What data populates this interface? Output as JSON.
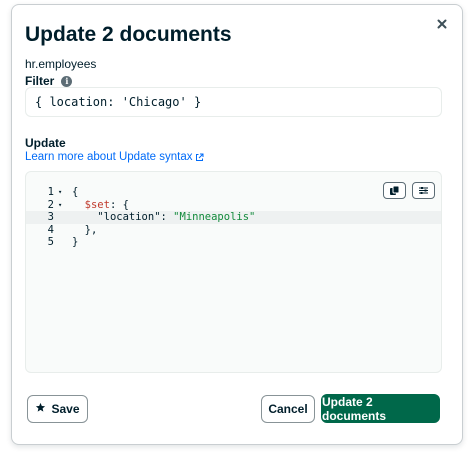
{
  "modal": {
    "title": "Update 2 documents",
    "namespace": "hr.employees",
    "close_icon": "close-icon"
  },
  "filter": {
    "label": "Filter",
    "info_icon": "info-icon",
    "value": "{ location: 'Chicago' }"
  },
  "update": {
    "label": "Update",
    "learn_more": "Learn more about Update syntax",
    "external_icon": "external-link-icon",
    "editor": {
      "lines": [
        {
          "num": "1",
          "fold": "▾",
          "parts": [
            {
              "t": "{",
              "c": "plain"
            }
          ]
        },
        {
          "num": "2",
          "fold": "▾",
          "parts": [
            {
              "t": "  ",
              "c": "plain"
            },
            {
              "t": "$set",
              "c": "key"
            },
            {
              "t": ": {",
              "c": "plain"
            }
          ]
        },
        {
          "num": "3",
          "fold": "",
          "parts": [
            {
              "t": "    ",
              "c": "plain"
            },
            {
              "t": "\"location\"",
              "c": "plain"
            },
            {
              "t": ": ",
              "c": "plain"
            },
            {
              "t": "\"Minneapolis\"",
              "c": "str"
            }
          ]
        },
        {
          "num": "4",
          "fold": "",
          "parts": [
            {
              "t": "  },",
              "c": "plain"
            }
          ]
        },
        {
          "num": "5",
          "fold": "",
          "parts": [
            {
              "t": "}",
              "c": "plain"
            }
          ]
        }
      ],
      "active_line": 3,
      "copy_icon": "copy-icon",
      "settings_icon": "settings-icon"
    }
  },
  "footer": {
    "save_label": "Save",
    "star_icon": "star-icon",
    "cancel_label": "Cancel",
    "primary_label": "Update 2 documents"
  },
  "colors": {
    "primary": "#00684a",
    "link": "#016bf8",
    "key": "#c0392b",
    "string": "#128a3b"
  }
}
